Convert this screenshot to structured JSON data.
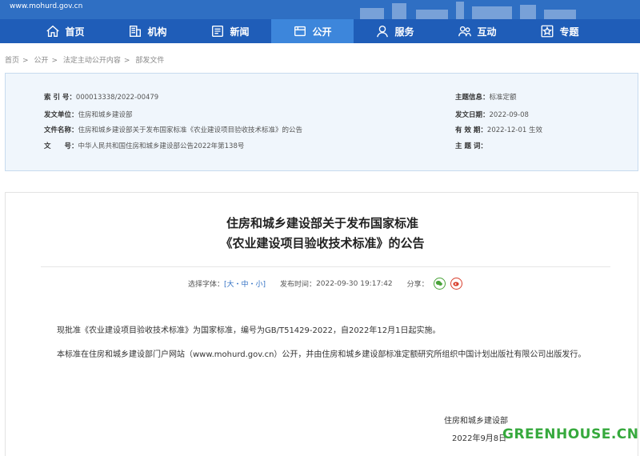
{
  "banner": {
    "site_url": "www.mohurd.gov.cn"
  },
  "nav": {
    "items": [
      {
        "label": "首页",
        "icon": "home-icon"
      },
      {
        "label": "机构",
        "icon": "building-icon"
      },
      {
        "label": "新闻",
        "icon": "news-icon"
      },
      {
        "label": "公开",
        "icon": "folder-icon",
        "active": true
      },
      {
        "label": "服务",
        "icon": "service-icon"
      },
      {
        "label": "互动",
        "icon": "people-icon"
      },
      {
        "label": "专题",
        "icon": "star-icon"
      }
    ]
  },
  "breadcrumb": [
    "首页",
    "公开",
    "法定主动公开内容",
    "部发文件"
  ],
  "meta": {
    "index_label": "索 引 号：",
    "index_value": "000013338/2022-00479",
    "unit_label": "发文单位：",
    "unit_value": "住房和城乡建设部",
    "filename_label": "文件名称：",
    "filename_value": "住房和城乡建设部关于发布国家标准《农业建设项目验收技术标准》的公告",
    "docno_label": "文　　号：",
    "docno_value": "中华人民共和国住房和城乡建设部公告2022年第138号",
    "topic_label": "主题信息：",
    "topic_value": "标准定额",
    "date_label": "发文日期：",
    "date_value": "2022-09-08",
    "valid_label": "有 效 期：",
    "valid_value": "2022-12-01 生效",
    "keyword_label": "主 题 词：",
    "keyword_value": ""
  },
  "article": {
    "title_line1": "住房和城乡建设部关于发布国家标准",
    "title_line2": "《农业建设项目验收技术标准》的公告",
    "font_label": "选择字体：",
    "font_sizes": "[大・中・小]",
    "pub_label": "发布时间：",
    "pub_time": "2022-09-30 19:17:42",
    "share_label": "分享：",
    "para1": "现批准《农业建设项目验收技术标准》为国家标准，编号为GB/T51429-2022，自2022年12月1日起实施。",
    "para2": "本标准在住房和城乡建设部门户网站（www.mohurd.gov.cn）公开，并由住房和城乡建设部标准定额研究所组织中国计划出版社有限公司出版发行。",
    "signer": "住房和城乡建设部",
    "sign_date": "2022年9月8日"
  },
  "watermark": "GREENHOUSE.CN",
  "colors": {
    "nav_bg": "#1f5db8",
    "nav_active": "#3d86db",
    "meta_bg": "#f0f6fc",
    "watermark": "#36a93d"
  }
}
